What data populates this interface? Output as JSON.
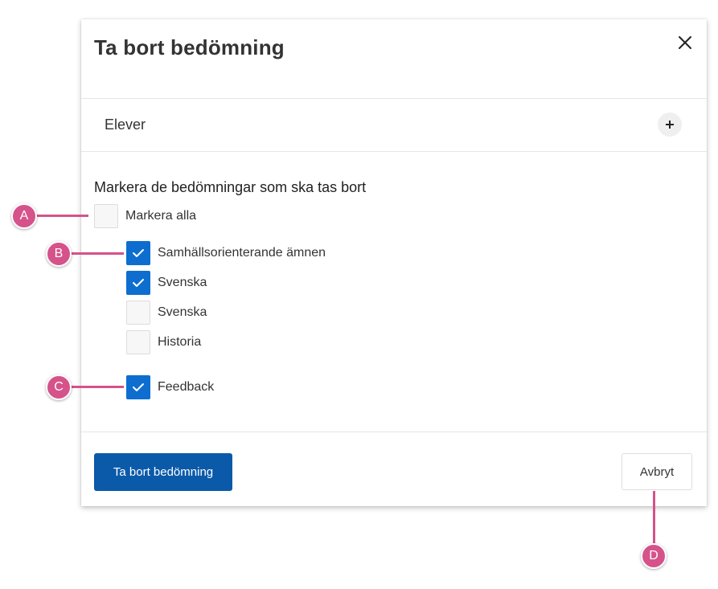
{
  "dialog": {
    "title": "Ta bort bedömning",
    "close_icon": "close-icon"
  },
  "section": {
    "label": "Elever",
    "expand_icon": "plus-icon"
  },
  "instruction": "Markera de bedömningar som ska tas bort",
  "select_all": {
    "label": "Markera alla",
    "checked": false
  },
  "items": [
    {
      "label": "Samhällsorienterande ämnen",
      "checked": true
    },
    {
      "label": "Svenska",
      "checked": true
    },
    {
      "label": "Svenska",
      "checked": false
    },
    {
      "label": "Historia",
      "checked": false
    },
    {
      "label": "Feedback",
      "checked": true
    }
  ],
  "buttons": {
    "primary": "Ta bort bedömning",
    "cancel": "Avbryt"
  },
  "callouts": [
    "A",
    "B",
    "C",
    "D"
  ],
  "colors": {
    "primary": "#0b5aa9",
    "checkbox_checked": "#0d6ecf",
    "callout": "#d6528a"
  }
}
